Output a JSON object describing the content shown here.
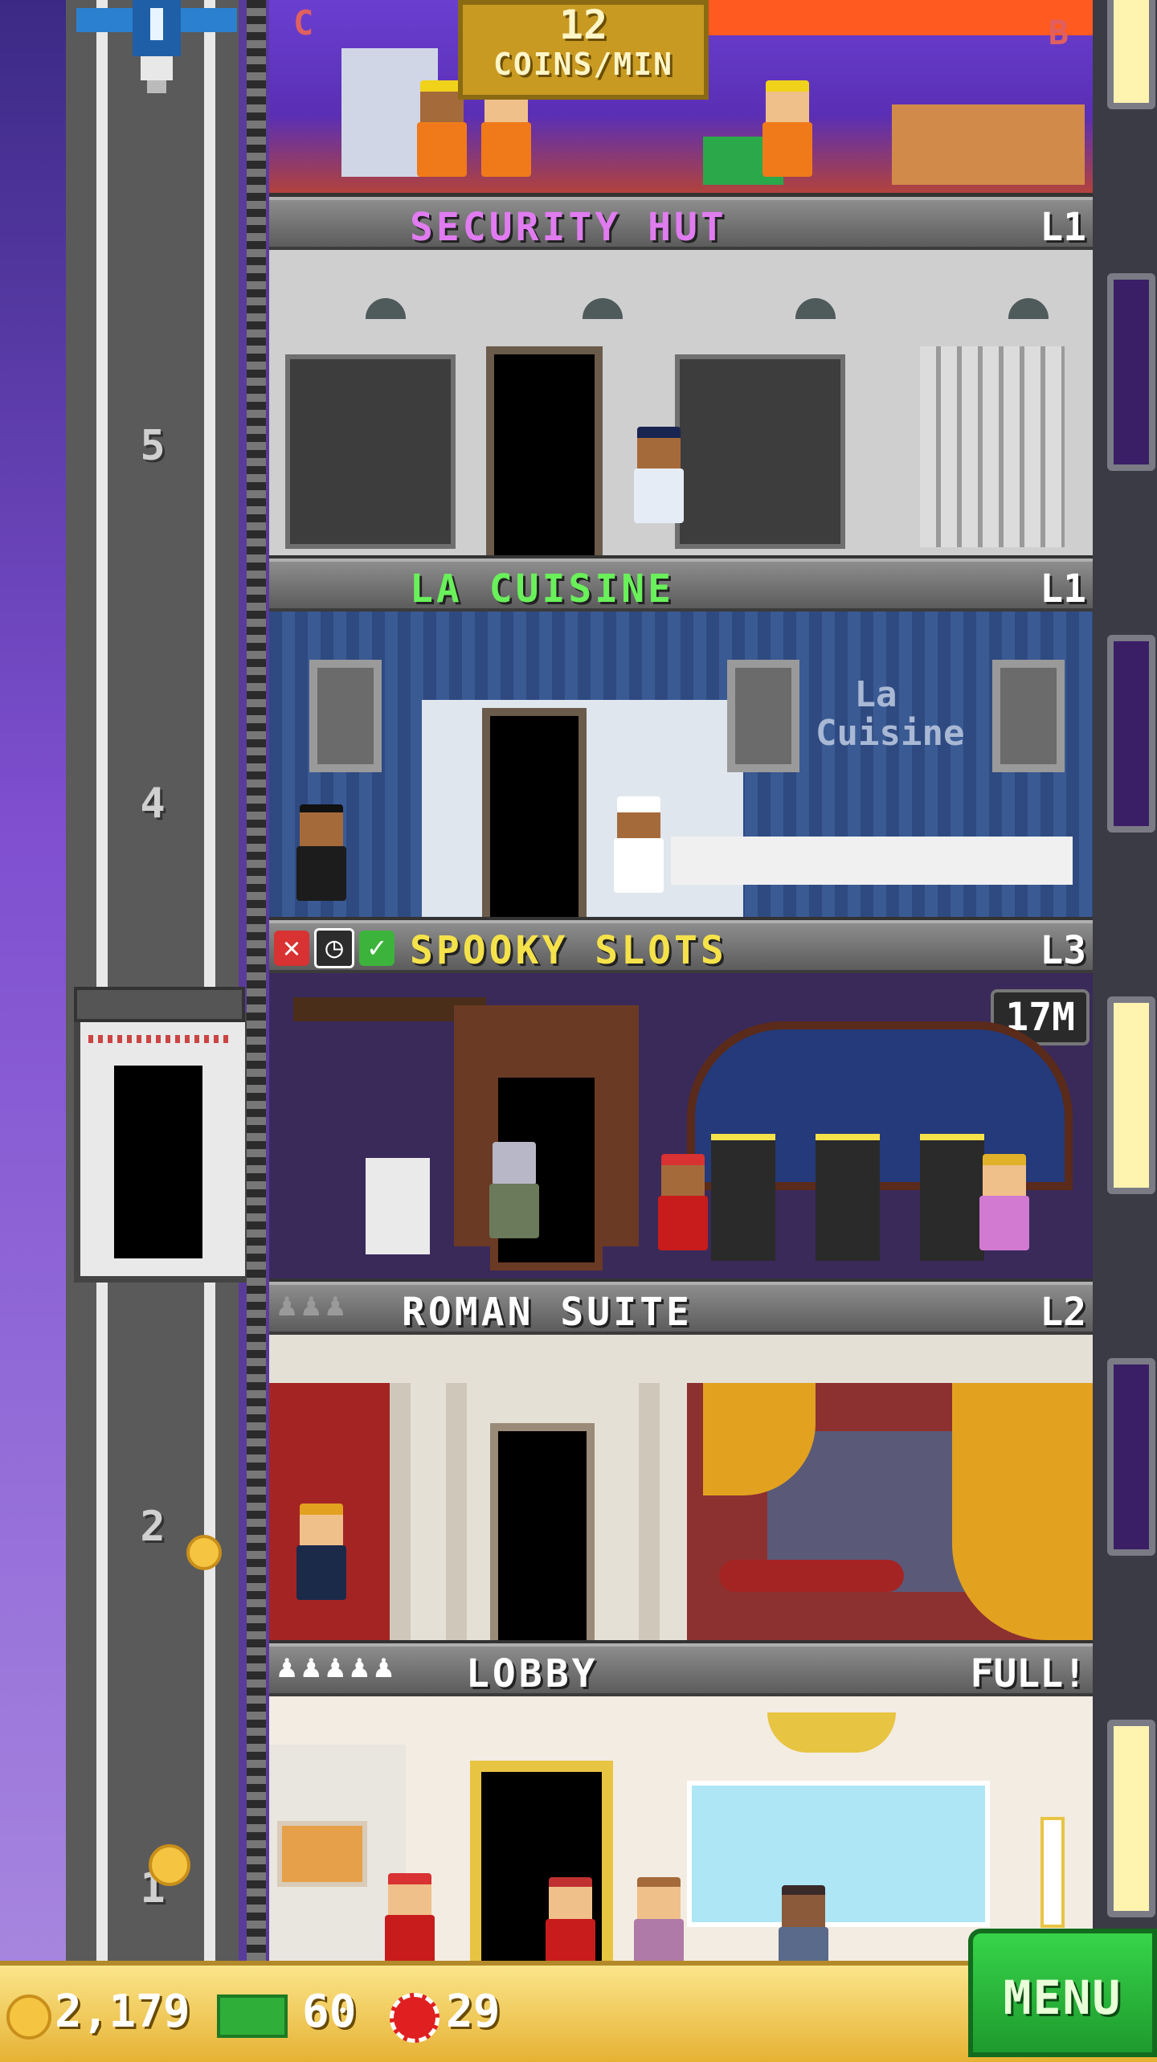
{
  "hud": {
    "coins_per_min": "12",
    "coins_per_min_unit": "COINS/MIN",
    "coins": "2,179",
    "bux": "60",
    "chips": "29",
    "menu_label": "MENU"
  },
  "shaft_levels": [
    "5",
    "4",
    "2",
    "1"
  ],
  "top_room": {
    "corner_left": "C",
    "corner_right": "B"
  },
  "floors": [
    {
      "name": "SECURITY HUT",
      "level": "L1",
      "name_color": "#e07cf0"
    },
    {
      "name": "LA CUISINE",
      "level": "L1",
      "name_color": "#69f05a"
    },
    {
      "name": "SPOOKY SLOTS",
      "level": "L3",
      "name_color": "#f5e24a",
      "badge": "17M"
    },
    {
      "name": "ROMAN SUITE",
      "level": "L2",
      "name_color": "#ffffff"
    },
    {
      "name": "LOBBY",
      "level": "FULL!",
      "name_color": "#ffffff"
    }
  ],
  "restaurant_sign": "La Cuisine",
  "icons": {
    "coin": "coin-icon",
    "bux": "tower-bux-icon",
    "chip": "casino-chip-icon",
    "cancel": "close-icon",
    "clock": "clock-icon",
    "confirm": "check-icon"
  },
  "colors": {
    "coin": "#f5c542",
    "bux": "#2fae3a",
    "chip": "#e02020",
    "menu": "#1e9a2d"
  }
}
